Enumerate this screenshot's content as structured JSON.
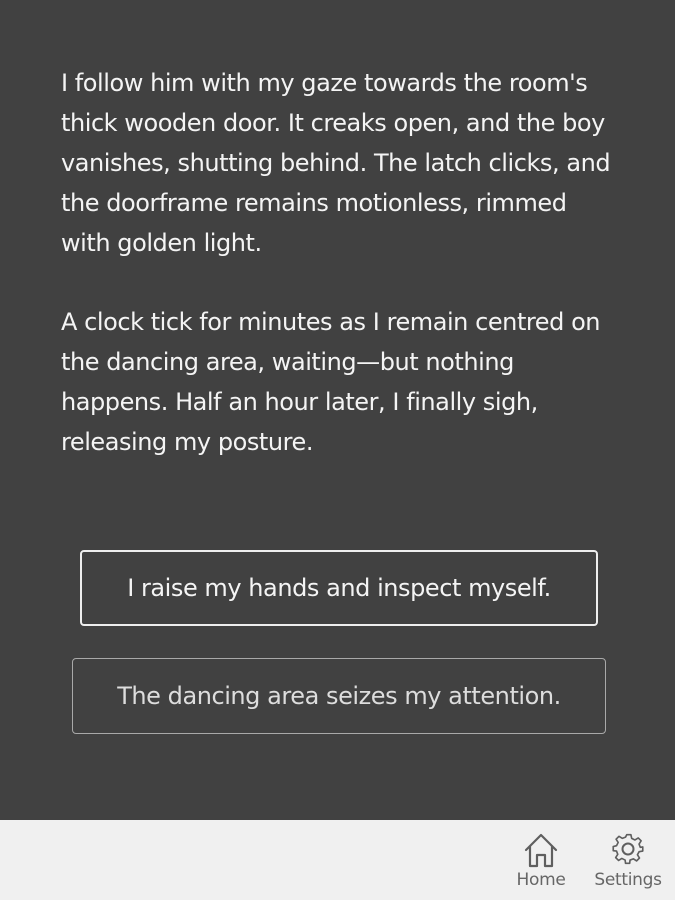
{
  "story": {
    "paragraphs": [
      "I follow him with my gaze towards the room's thick wooden door. It creaks open, and the boy vanishes, shutting behind. The latch clicks, and the doorframe remains motionless, rimmed with golden light.",
      "A clock tick for minutes as I remain centred on the dancing area, waiting—but nothing happens. Half an hour later, I finally sigh, releasing my posture."
    ]
  },
  "choices": [
    {
      "label": "I raise my hands and inspect myself."
    },
    {
      "label": "The dancing area seizes my attention."
    }
  ],
  "nav": {
    "home": {
      "label": "Home",
      "icon": "home-icon"
    },
    "settings": {
      "label": "Settings",
      "icon": "gear-icon"
    }
  },
  "colors": {
    "background": "#414141",
    "text": "#f4f4f4",
    "bottom_bar": "#f0f0f0",
    "nav_icon": "#5f5f5f"
  }
}
